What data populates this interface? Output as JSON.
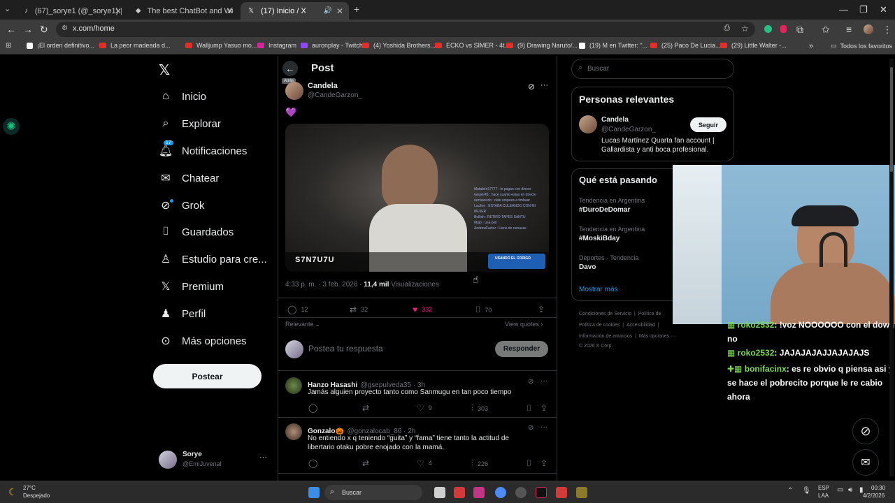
{
  "browser": {
    "tabs": [
      {
        "title": "(67)_sorye1 (@_sorye1) | TikTok",
        "icon": "tiktok-icon"
      },
      {
        "title": "The best ChatBot and Widgets",
        "icon": "chatbot-icon"
      },
      {
        "title": "(17) Inicio / X",
        "icon": "x-icon"
      }
    ],
    "url": "x.com/home",
    "bookmarks": [
      "¡El orden definitivo...",
      "La peor madeada d...",
      "Walljump Yasuo mo...",
      "Instagram",
      "auronplay - Twitch",
      "(4) Yoshida Brothers...",
      "ECKO vs SIMER - 4t...",
      "(9) Drawing Naruto/...",
      "(19) M en Twitter: \"...",
      "(25) Paco De Lucia...",
      "(29) Little Walter -..."
    ],
    "all_bookmarks": "Todos los favoritos"
  },
  "nav": {
    "items": [
      {
        "label": "Inicio",
        "icon": "home-icon"
      },
      {
        "label": "Explorar",
        "icon": "search-icon"
      },
      {
        "label": "Notificaciones",
        "icon": "bell-icon",
        "badge": "17"
      },
      {
        "label": "Chatear",
        "icon": "mail-icon"
      },
      {
        "label": "Grok",
        "icon": "grok-icon"
      },
      {
        "label": "Guardados",
        "icon": "bookmark-icon"
      },
      {
        "label": "Estudio para cre...",
        "icon": "studio-icon"
      },
      {
        "label": "Premium",
        "icon": "x-icon"
      },
      {
        "label": "Perfil",
        "icon": "person-icon"
      },
      {
        "label": "Más opciones",
        "icon": "more-circle-icon"
      }
    ],
    "post_button": "Postear",
    "account": {
      "name": "Sorye",
      "handle": "@EmiJuvenal"
    }
  },
  "post": {
    "header": "Post",
    "back_tooltip": "Atrás",
    "author": "Candela",
    "handle": "@CandeGarzon_",
    "emoji": "💜",
    "video_overlay_name": "S7N7U7U",
    "video_overlay_code": "USANDO EL CODIGO",
    "time": "4:33 p. m. · 3 feb. 2026 ·",
    "views_count": "11,4 mil",
    "views_label": "Visualizaciones",
    "replies": "12",
    "reposts": "32",
    "likes": "332",
    "bookmarks": "70",
    "sort": "Relevante",
    "view_quotes": "View quotes",
    "reply_placeholder": "Postea tu respuesta",
    "reply_button": "Responder"
  },
  "replies": [
    {
      "name": "Hanzo Hasashi",
      "handle": "@gsepulveda35 · 3h",
      "text": "Jamás alguien proyecto tanto como Sanmugu en tan poco tiempo",
      "replies": "",
      "reposts": "",
      "likes": "9",
      "views": "303"
    },
    {
      "name": "Gonzalo🎃",
      "handle": "@gonzalocab_86 · 2h",
      "text": "No entiendo x q teniendo “guita” y “fama” tiene tanto la actitud de libertario otaku pobre enojado con la mamá.",
      "replies": "",
      "reposts": "",
      "likes": "4",
      "views": "226"
    }
  ],
  "right": {
    "search_placeholder": "Buscar",
    "relevant_title": "Personas relevantes",
    "relevant": {
      "name": "Candela",
      "handle": "@CandeGarzon_",
      "bio": "Lucas Martínez Quarta fan account | Gallardista y anti boca profesional.",
      "follow": "Seguir"
    },
    "trends_title": "Qué está pasando",
    "trends": [
      {
        "category": "Tendencia en Argentina",
        "name": "#DuroDeDomar"
      },
      {
        "category": "Tendencia en Argentina",
        "name": "#MoskiBday"
      },
      {
        "category": "Deportes · Tendencia",
        "name": "Davo"
      }
    ],
    "show_more": "Mostrar más",
    "footer_line1": [
      "Condiciones de Servicio",
      "|",
      "Política de"
    ],
    "footer_line2": [
      "Política de cookies",
      "|",
      "Accesibilidad",
      "|"
    ],
    "footer_line3": [
      "Información de anuncios",
      "|",
      "Más opciones ···"
    ],
    "copyright": "© 2026 X Corp."
  },
  "stream_chat": [
    {
      "user": "roko2532",
      "text": ": !voz NOOOOOO con el down no"
    },
    {
      "user": "roko2532",
      "text": ": JAJAJAJAJJAJAJAJS"
    },
    {
      "user": "bonifacinx",
      "text": ": es re obvio q piensa asi y se hace el pobrecito porque le re cabio ahora"
    }
  ],
  "taskbar": {
    "weather_temp": "27°C",
    "weather_desc": "Despejado",
    "search": "Buscar",
    "lang": "ESP",
    "lang2": "LAA",
    "time": "00:30",
    "date": "4/2/2026"
  },
  "colors": {
    "like": "#f91880",
    "accent": "#1d9bf0",
    "chat_user": "#7ed957"
  }
}
